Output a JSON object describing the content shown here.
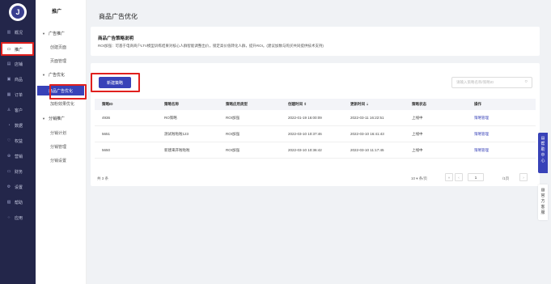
{
  "nav": {
    "logo_text": "J",
    "items": [
      {
        "icon": "▥",
        "label": "概况"
      },
      {
        "icon": "▭",
        "label": "推广"
      },
      {
        "icon": "▤",
        "label": "店铺"
      },
      {
        "icon": "▣",
        "label": "商品"
      },
      {
        "icon": "▦",
        "label": "订单"
      },
      {
        "icon": "♙",
        "label": "客户"
      },
      {
        "icon": "◔",
        "label": "数据"
      },
      {
        "icon": "♡",
        "label": "权益"
      },
      {
        "icon": "⊕",
        "label": "营销"
      },
      {
        "icon": "▭",
        "label": "财务"
      },
      {
        "icon": "⚙",
        "label": "设置"
      },
      {
        "icon": "▧",
        "label": "帮助"
      },
      {
        "icon": "⁘",
        "label": "应用"
      }
    ]
  },
  "side": {
    "title": "推广",
    "groups": [
      {
        "label": "广告推广",
        "items": [
          "创建页面",
          "页面管理"
        ]
      },
      {
        "label": "广告优化",
        "items": [
          "商品广告优化",
          "加粉效果优化"
        ]
      },
      {
        "label": "分销推广",
        "items": [
          "分销计划",
          "分销管理",
          "分销设置"
        ]
      }
    ]
  },
  "page_title": "商品广告优化",
  "info": {
    "title": "商品广告策略说明",
    "desc": "ROI加强：可基于电商商户LTV模型训练结果对核心人群智能调整出价，锁定高价值转化人群，提升ROI。(建议加数与购买共同提供技术支持)"
  },
  "toolbar": {
    "new_button": "新建策略",
    "search_placeholder": "请输入策略名称/策略ID"
  },
  "table": {
    "headers": [
      "策略ID",
      "策略名称",
      "策略应用类型",
      "创建时间 ⇕",
      "更新时间 ⇣",
      "策略状态",
      "操作"
    ],
    "rows": [
      [
        "4936",
        "RO策略",
        "ROI加强",
        "2022-01-19 16:00:09",
        "2022-03-11 16:22:51",
        "上线中",
        "策略管理"
      ],
      [
        "5651",
        "测试啦啦啦123",
        "ROI加强",
        "2022-03-10 10:37:46",
        "2022-03-10 16:41:43",
        "上线中",
        "策略管理"
      ],
      [
        "5650",
        "新建来开啦啦啦",
        "ROI加强",
        "2022-03-10 10:36:42",
        "2022-03-10 11:17:45",
        "上线中",
        "策略管理"
      ]
    ]
  },
  "pager": {
    "total": "共 3 条",
    "page_size": "10 ▾ 条/页",
    "prev": "‹",
    "first": "«",
    "current": "1",
    "pages": "/1页",
    "next": "›"
  },
  "float": {
    "help": [
      "▤",
      "帮",
      "助",
      "中",
      "心"
    ],
    "service": [
      "▨",
      "官",
      "方",
      "客",
      "服"
    ]
  },
  "colors": {
    "primary": "#3842b8",
    "nav_bg": "#23264a",
    "highlight": "#e0201e"
  }
}
